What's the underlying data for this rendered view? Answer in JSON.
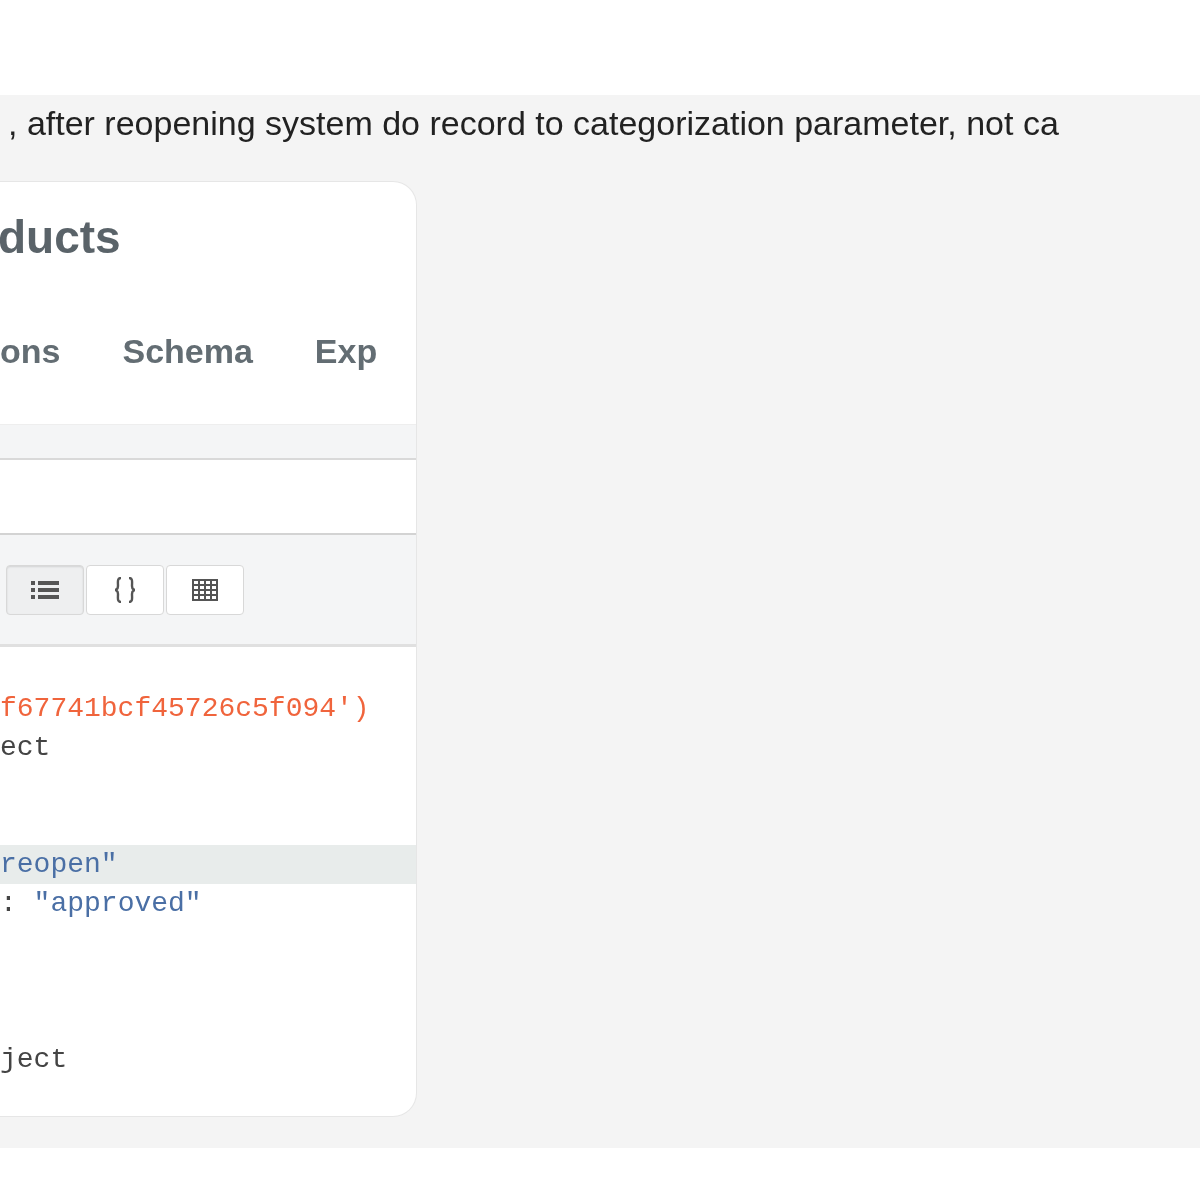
{
  "description": ", after reopening system do record to categorization parameter, not ca",
  "card": {
    "title": "ducts",
    "tabs": [
      {
        "label": "ons"
      },
      {
        "label": "Schema"
      },
      {
        "label": "Exp"
      }
    ],
    "view_buttons": [
      {
        "kind": "list",
        "selected": true
      },
      {
        "kind": "json",
        "selected": false
      },
      {
        "kind": "table",
        "selected": false
      }
    ],
    "code_lines": [
      {
        "highlighted": false,
        "segments": [
          {
            "kind": "id",
            "text": "f67741bcf45726c5f094')"
          }
        ]
      },
      {
        "highlighted": false,
        "segments": [
          {
            "kind": "plain",
            "text": "ect"
          }
        ]
      },
      {
        "highlighted": false
      },
      {
        "highlighted": false
      },
      {
        "highlighted": true,
        "segments": [
          {
            "kind": "string",
            "text": "reopen\""
          }
        ]
      },
      {
        "highlighted": false,
        "segments": [
          {
            "kind": "plain",
            "text": ":"
          },
          {
            "kind": "string",
            "text": " \"approved\""
          }
        ]
      },
      {
        "highlighted": false
      },
      {
        "highlighted": false
      },
      {
        "highlighted": false
      },
      {
        "highlighted": false,
        "segments": [
          {
            "kind": "plain",
            "text": "ject"
          }
        ]
      }
    ]
  }
}
